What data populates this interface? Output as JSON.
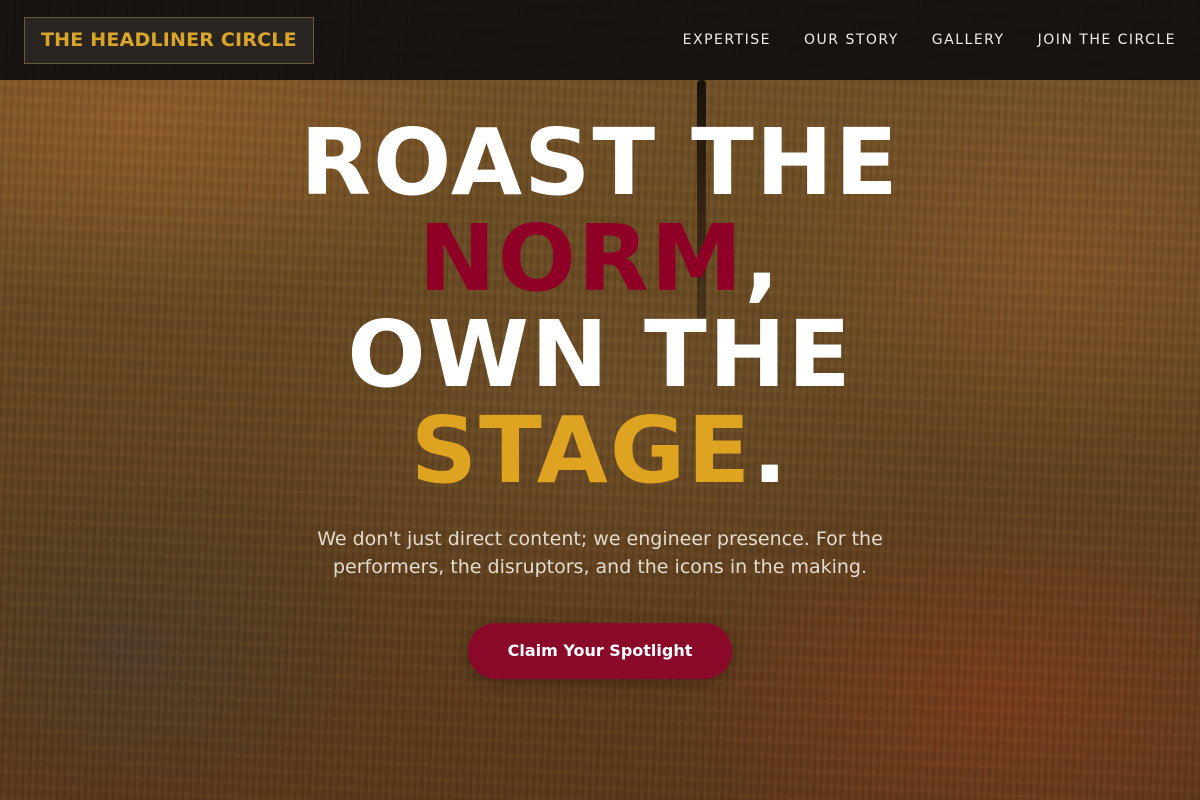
{
  "brand": {
    "logo_text": "THE HEADLINER CIRCLE"
  },
  "nav": {
    "links": [
      "EXPERTISE",
      "OUR STORY",
      "GALLERY",
      "JOIN THE CIRCLE"
    ]
  },
  "hero": {
    "line1": "ROAST THE",
    "line2_highlight": "NORM",
    "line2_suffix": ",",
    "line3": "OWN THE",
    "line4_highlight": "STAGE",
    "line4_suffix": ".",
    "subtitle": "We don't just direct content; we engineer presence. For the performers, the disruptors, and the icons in the making.",
    "cta_label": "Claim Your Spotlight"
  },
  "colors": {
    "brand_gold": "#dea320",
    "brand_red": "#8e0025",
    "button_red": "#8a0828",
    "navbar_bg": "#16120f"
  }
}
